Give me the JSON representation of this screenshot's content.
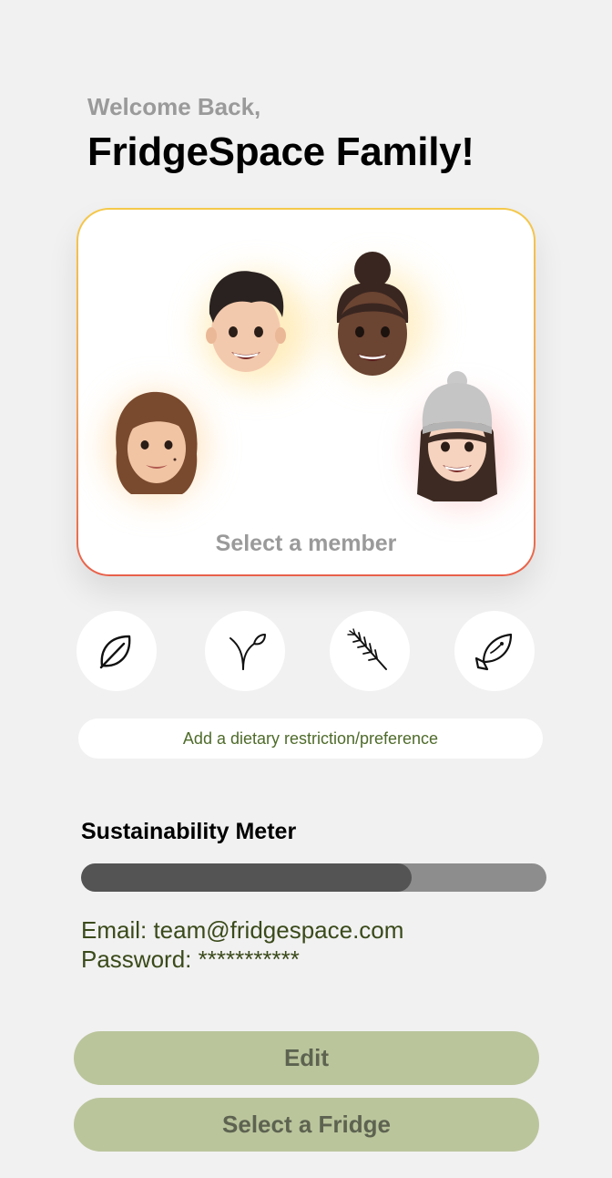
{
  "header": {
    "welcome": "Welcome Back,",
    "title": "FridgeSpace Family!"
  },
  "members": {
    "prompt": "Select a member",
    "avatars": [
      {
        "name": "avatar-boy-dark-hair",
        "skin": "#f3c9ad",
        "hair": "#2a2220"
      },
      {
        "name": "avatar-girl-hair-bun",
        "skin": "#6b4432",
        "hair": "#3a2620"
      },
      {
        "name": "avatar-woman-brown-hair",
        "skin": "#f1c4a4",
        "hair": "#7a4a2e"
      },
      {
        "name": "avatar-girl-beanie",
        "skin": "#f6d3bf",
        "hair": "#3d2b23"
      }
    ]
  },
  "diet": {
    "icons": [
      "leaf-icon",
      "sprout-icon",
      "wheat-icon",
      "fish-icon"
    ],
    "add_label": "Add a dietary restriction/preference"
  },
  "sustainability": {
    "title": "Sustainability Meter",
    "level": 0.71
  },
  "account": {
    "email": "Email: team@fridgespace.com",
    "password": "Password: ***********"
  },
  "actions": {
    "edit_label": "Edit",
    "select_fridge_label": "Select a Fridge"
  },
  "colors": {
    "background": "#f1f1f1",
    "accent_green": "#4e6b2a",
    "button_green": "#bbc59c",
    "meter_fill": "#545454",
    "meter_track": "#8d8d8d"
  }
}
